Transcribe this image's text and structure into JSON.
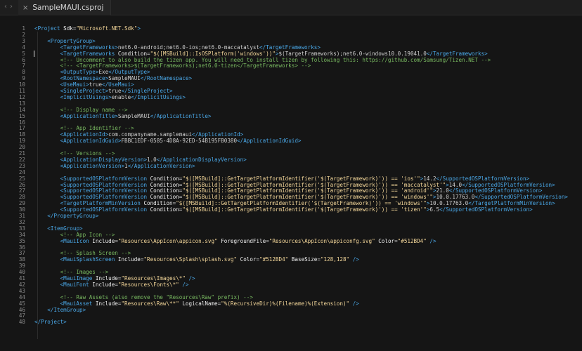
{
  "tab": {
    "title": "SampleMAUI.csproj"
  },
  "nav": {
    "back": "‹",
    "forward": "›"
  },
  "lines": [
    {
      "n": "1",
      "tokens": [
        {
          "k": "t",
          "v": "<Project "
        },
        {
          "k": "a",
          "v": "Sdk"
        },
        {
          "k": "p",
          "v": "="
        },
        {
          "k": "s",
          "v": "\"Microsoft.NET.Sdk\""
        },
        {
          "k": "t",
          "v": ">"
        }
      ]
    },
    {
      "n": "2",
      "tokens": []
    },
    {
      "n": "3",
      "tokens": [
        {
          "k": "p",
          "v": "    "
        },
        {
          "k": "t",
          "v": "<PropertyGroup>"
        }
      ]
    },
    {
      "n": "4",
      "tokens": [
        {
          "k": "p",
          "v": "        "
        },
        {
          "k": "t",
          "v": "<TargetFrameworks>"
        },
        {
          "k": "p",
          "v": "net6.0-android;net6.0-ios;net6.0-maccatalyst"
        },
        {
          "k": "t",
          "v": "</TargetFrameworks>"
        }
      ]
    },
    {
      "n": "5",
      "tokens": [
        {
          "k": "p",
          "v": "        "
        },
        {
          "k": "t",
          "v": "<TargetFrameworks "
        },
        {
          "k": "a",
          "v": "Condition"
        },
        {
          "k": "p",
          "v": "="
        },
        {
          "k": "s",
          "v": "\"$([MSBuild]::IsOSPlatform('windows'))\""
        },
        {
          "k": "t",
          "v": ">"
        },
        {
          "k": "p",
          "v": "$(TargetFrameworks);net6.0-windows10.0.19041.0"
        },
        {
          "k": "t",
          "v": "</TargetFrameworks>"
        }
      ]
    },
    {
      "n": "6",
      "tokens": [
        {
          "k": "p",
          "v": "        "
        },
        {
          "k": "c",
          "v": "<!-- Uncomment to also build the tizen app. You will need to install tizen by following this: https://github.com/Samsung/Tizen.NET -->"
        }
      ]
    },
    {
      "n": "7",
      "tokens": [
        {
          "k": "p",
          "v": "        "
        },
        {
          "k": "c",
          "v": "<!-- <TargetFrameworks>$(TargetFrameworks);net6.0-tizen</TargetFrameworks> -->"
        }
      ]
    },
    {
      "n": "8",
      "tokens": [
        {
          "k": "p",
          "v": "        "
        },
        {
          "k": "t",
          "v": "<OutputType>"
        },
        {
          "k": "p",
          "v": "Exe"
        },
        {
          "k": "t",
          "v": "</OutputType>"
        }
      ]
    },
    {
      "n": "9",
      "tokens": [
        {
          "k": "p",
          "v": "        "
        },
        {
          "k": "t",
          "v": "<RootNamespace>"
        },
        {
          "k": "p",
          "v": "SampleMAUI"
        },
        {
          "k": "t",
          "v": "</RootNamespace>"
        }
      ]
    },
    {
      "n": "10",
      "tokens": [
        {
          "k": "p",
          "v": "        "
        },
        {
          "k": "t",
          "v": "<UseMaui>"
        },
        {
          "k": "p",
          "v": "true"
        },
        {
          "k": "t",
          "v": "</UseMaui>"
        }
      ]
    },
    {
      "n": "11",
      "tokens": [
        {
          "k": "p",
          "v": "        "
        },
        {
          "k": "t",
          "v": "<SingleProject>"
        },
        {
          "k": "p",
          "v": "true"
        },
        {
          "k": "t",
          "v": "</SingleProject>"
        }
      ]
    },
    {
      "n": "12",
      "tokens": [
        {
          "k": "p",
          "v": "        "
        },
        {
          "k": "t",
          "v": "<ImplicitUsings>"
        },
        {
          "k": "p",
          "v": "enable"
        },
        {
          "k": "t",
          "v": "</ImplicitUsings>"
        }
      ]
    },
    {
      "n": "13",
      "tokens": []
    },
    {
      "n": "14",
      "tokens": [
        {
          "k": "p",
          "v": "        "
        },
        {
          "k": "c",
          "v": "<!-- Display name -->"
        }
      ]
    },
    {
      "n": "15",
      "tokens": [
        {
          "k": "p",
          "v": "        "
        },
        {
          "k": "t",
          "v": "<ApplicationTitle>"
        },
        {
          "k": "p",
          "v": "SampleMAUI"
        },
        {
          "k": "t",
          "v": "</ApplicationTitle>"
        }
      ]
    },
    {
      "n": "16",
      "tokens": []
    },
    {
      "n": "17",
      "tokens": [
        {
          "k": "p",
          "v": "        "
        },
        {
          "k": "c",
          "v": "<!-- App Identifier -->"
        }
      ]
    },
    {
      "n": "18",
      "tokens": [
        {
          "k": "p",
          "v": "        "
        },
        {
          "k": "t",
          "v": "<ApplicationId>"
        },
        {
          "k": "p",
          "v": "com.companyname.samplemaui"
        },
        {
          "k": "t",
          "v": "</ApplicationId>"
        }
      ]
    },
    {
      "n": "19",
      "tokens": [
        {
          "k": "p",
          "v": "        "
        },
        {
          "k": "t",
          "v": "<ApplicationIdGuid>"
        },
        {
          "k": "p",
          "v": "FBBC1EDF-0585-4D8A-92ED-54B195FB0380"
        },
        {
          "k": "t",
          "v": "</ApplicationIdGuid>"
        }
      ]
    },
    {
      "n": "20",
      "tokens": []
    },
    {
      "n": "21",
      "tokens": [
        {
          "k": "p",
          "v": "        "
        },
        {
          "k": "c",
          "v": "<!-- Versions -->"
        }
      ]
    },
    {
      "n": "22",
      "tokens": [
        {
          "k": "p",
          "v": "        "
        },
        {
          "k": "t",
          "v": "<ApplicationDisplayVersion>"
        },
        {
          "k": "p",
          "v": "1.0"
        },
        {
          "k": "t",
          "v": "</ApplicationDisplayVersion>"
        }
      ]
    },
    {
      "n": "23",
      "tokens": [
        {
          "k": "p",
          "v": "        "
        },
        {
          "k": "t",
          "v": "<ApplicationVersion>"
        },
        {
          "k": "p",
          "v": "1"
        },
        {
          "k": "t",
          "v": "</ApplicationVersion>"
        }
      ]
    },
    {
      "n": "24",
      "tokens": []
    },
    {
      "n": "25",
      "tokens": [
        {
          "k": "p",
          "v": "        "
        },
        {
          "k": "t",
          "v": "<SupportedOSPlatformVersion "
        },
        {
          "k": "a",
          "v": "Condition"
        },
        {
          "k": "p",
          "v": "="
        },
        {
          "k": "s",
          "v": "\"$([MSBuild]::GetTargetPlatformIdentifier('$(TargetFramework)')) == 'ios'\""
        },
        {
          "k": "t",
          "v": ">"
        },
        {
          "k": "p",
          "v": "14.2"
        },
        {
          "k": "t",
          "v": "</SupportedOSPlatformVersion>"
        }
      ]
    },
    {
      "n": "26",
      "tokens": [
        {
          "k": "p",
          "v": "        "
        },
        {
          "k": "t",
          "v": "<SupportedOSPlatformVersion "
        },
        {
          "k": "a",
          "v": "Condition"
        },
        {
          "k": "p",
          "v": "="
        },
        {
          "k": "s",
          "v": "\"$([MSBuild]::GetTargetPlatformIdentifier('$(TargetFramework)')) == 'maccatalyst'\""
        },
        {
          "k": "t",
          "v": ">"
        },
        {
          "k": "p",
          "v": "14.0"
        },
        {
          "k": "t",
          "v": "</SupportedOSPlatformVersion>"
        }
      ]
    },
    {
      "n": "27",
      "tokens": [
        {
          "k": "p",
          "v": "        "
        },
        {
          "k": "t",
          "v": "<SupportedOSPlatformVersion "
        },
        {
          "k": "a",
          "v": "Condition"
        },
        {
          "k": "p",
          "v": "="
        },
        {
          "k": "s",
          "v": "\"$([MSBuild]::GetTargetPlatformIdentifier('$(TargetFramework)')) == 'android'\""
        },
        {
          "k": "t",
          "v": ">"
        },
        {
          "k": "p",
          "v": "21.0"
        },
        {
          "k": "t",
          "v": "</SupportedOSPlatformVersion>"
        }
      ]
    },
    {
      "n": "28",
      "tokens": [
        {
          "k": "p",
          "v": "        "
        },
        {
          "k": "t",
          "v": "<SupportedOSPlatformVersion "
        },
        {
          "k": "a",
          "v": "Condition"
        },
        {
          "k": "p",
          "v": "="
        },
        {
          "k": "s",
          "v": "\"$([MSBuild]::GetTargetPlatformIdentifier('$(TargetFramework)')) == 'windows'\""
        },
        {
          "k": "t",
          "v": ">"
        },
        {
          "k": "p",
          "v": "10.0.17763.0"
        },
        {
          "k": "t",
          "v": "</SupportedOSPlatformVersion>"
        }
      ]
    },
    {
      "n": "29",
      "tokens": [
        {
          "k": "p",
          "v": "        "
        },
        {
          "k": "t",
          "v": "<TargetPlatformMinVersion "
        },
        {
          "k": "a",
          "v": "Condition"
        },
        {
          "k": "p",
          "v": "="
        },
        {
          "k": "s",
          "v": "\"$([MSBuild]::GetTargetPlatformIdentifier('$(TargetFramework)')) == 'windows'\""
        },
        {
          "k": "t",
          "v": ">"
        },
        {
          "k": "p",
          "v": "10.0.17763.0"
        },
        {
          "k": "t",
          "v": "</TargetPlatformMinVersion>"
        }
      ]
    },
    {
      "n": "30",
      "tokens": [
        {
          "k": "p",
          "v": "        "
        },
        {
          "k": "t",
          "v": "<SupportedOSPlatformVersion "
        },
        {
          "k": "a",
          "v": "Condition"
        },
        {
          "k": "p",
          "v": "="
        },
        {
          "k": "s",
          "v": "\"$([MSBuild]::GetTargetPlatformIdentifier('$(TargetFramework)')) == 'tizen'\""
        },
        {
          "k": "t",
          "v": ">"
        },
        {
          "k": "p",
          "v": "6.5"
        },
        {
          "k": "t",
          "v": "</SupportedOSPlatformVersion>"
        }
      ]
    },
    {
      "n": "31",
      "tokens": [
        {
          "k": "p",
          "v": "    "
        },
        {
          "k": "t",
          "v": "</PropertyGroup>"
        }
      ]
    },
    {
      "n": "32",
      "tokens": []
    },
    {
      "n": "33",
      "tokens": [
        {
          "k": "p",
          "v": "    "
        },
        {
          "k": "t",
          "v": "<ItemGroup>"
        }
      ]
    },
    {
      "n": "34",
      "tokens": [
        {
          "k": "p",
          "v": "        "
        },
        {
          "k": "c",
          "v": "<!-- App Icon -->"
        }
      ]
    },
    {
      "n": "35",
      "tokens": [
        {
          "k": "p",
          "v": "        "
        },
        {
          "k": "t",
          "v": "<MauiIcon "
        },
        {
          "k": "a",
          "v": "Include"
        },
        {
          "k": "p",
          "v": "="
        },
        {
          "k": "s",
          "v": "\"Resources\\AppIcon\\appicon.svg\""
        },
        {
          "k": "a",
          "v": " ForegroundFile"
        },
        {
          "k": "p",
          "v": "="
        },
        {
          "k": "s",
          "v": "\"Resources\\AppIcon\\appiconfg.svg\""
        },
        {
          "k": "a",
          "v": " Color"
        },
        {
          "k": "p",
          "v": "="
        },
        {
          "k": "s",
          "v": "\"#512BD4\""
        },
        {
          "k": "t",
          "v": " />"
        }
      ]
    },
    {
      "n": "36",
      "tokens": []
    },
    {
      "n": "37",
      "tokens": [
        {
          "k": "p",
          "v": "        "
        },
        {
          "k": "c",
          "v": "<!-- Splash Screen -->"
        }
      ]
    },
    {
      "n": "38",
      "tokens": [
        {
          "k": "p",
          "v": "        "
        },
        {
          "k": "t",
          "v": "<MauiSplashScreen "
        },
        {
          "k": "a",
          "v": "Include"
        },
        {
          "k": "p",
          "v": "="
        },
        {
          "k": "s",
          "v": "\"Resources\\Splash\\splash.svg\""
        },
        {
          "k": "a",
          "v": " Color"
        },
        {
          "k": "p",
          "v": "="
        },
        {
          "k": "s",
          "v": "\"#512BD4\""
        },
        {
          "k": "a",
          "v": " BaseSize"
        },
        {
          "k": "p",
          "v": "="
        },
        {
          "k": "s",
          "v": "\"128,128\""
        },
        {
          "k": "t",
          "v": " />"
        }
      ]
    },
    {
      "n": "39",
      "tokens": []
    },
    {
      "n": "40",
      "tokens": [
        {
          "k": "p",
          "v": "        "
        },
        {
          "k": "c",
          "v": "<!-- Images -->"
        }
      ]
    },
    {
      "n": "41",
      "tokens": [
        {
          "k": "p",
          "v": "        "
        },
        {
          "k": "t",
          "v": "<MauiImage "
        },
        {
          "k": "a",
          "v": "Include"
        },
        {
          "k": "p",
          "v": "="
        },
        {
          "k": "s",
          "v": "\"Resources\\Images\\*\""
        },
        {
          "k": "t",
          "v": " />"
        }
      ]
    },
    {
      "n": "42",
      "tokens": [
        {
          "k": "p",
          "v": "        "
        },
        {
          "k": "t",
          "v": "<MauiFont "
        },
        {
          "k": "a",
          "v": "Include"
        },
        {
          "k": "p",
          "v": "="
        },
        {
          "k": "s",
          "v": "\"Resources\\Fonts\\*\""
        },
        {
          "k": "t",
          "v": " />"
        }
      ]
    },
    {
      "n": "43",
      "tokens": []
    },
    {
      "n": "44",
      "tokens": [
        {
          "k": "p",
          "v": "        "
        },
        {
          "k": "c",
          "v": "<!-- Raw Assets (also remove the \"Resources\\Raw\" prefix) -->"
        }
      ]
    },
    {
      "n": "45",
      "tokens": [
        {
          "k": "p",
          "v": "        "
        },
        {
          "k": "t",
          "v": "<MauiAsset "
        },
        {
          "k": "a",
          "v": "Include"
        },
        {
          "k": "p",
          "v": "="
        },
        {
          "k": "s",
          "v": "\"Resources\\Raw\\**\""
        },
        {
          "k": "a",
          "v": " LogicalName"
        },
        {
          "k": "p",
          "v": "="
        },
        {
          "k": "s",
          "v": "\"%(RecursiveDir)%(Filename)%(Extension)\""
        },
        {
          "k": "t",
          "v": " />"
        }
      ]
    },
    {
      "n": "46",
      "tokens": [
        {
          "k": "p",
          "v": "    "
        },
        {
          "k": "t",
          "v": "</ItemGroup>"
        }
      ]
    },
    {
      "n": "47",
      "tokens": []
    },
    {
      "n": "48",
      "tokens": [
        {
          "k": "t",
          "v": "</Project>"
        }
      ]
    }
  ]
}
